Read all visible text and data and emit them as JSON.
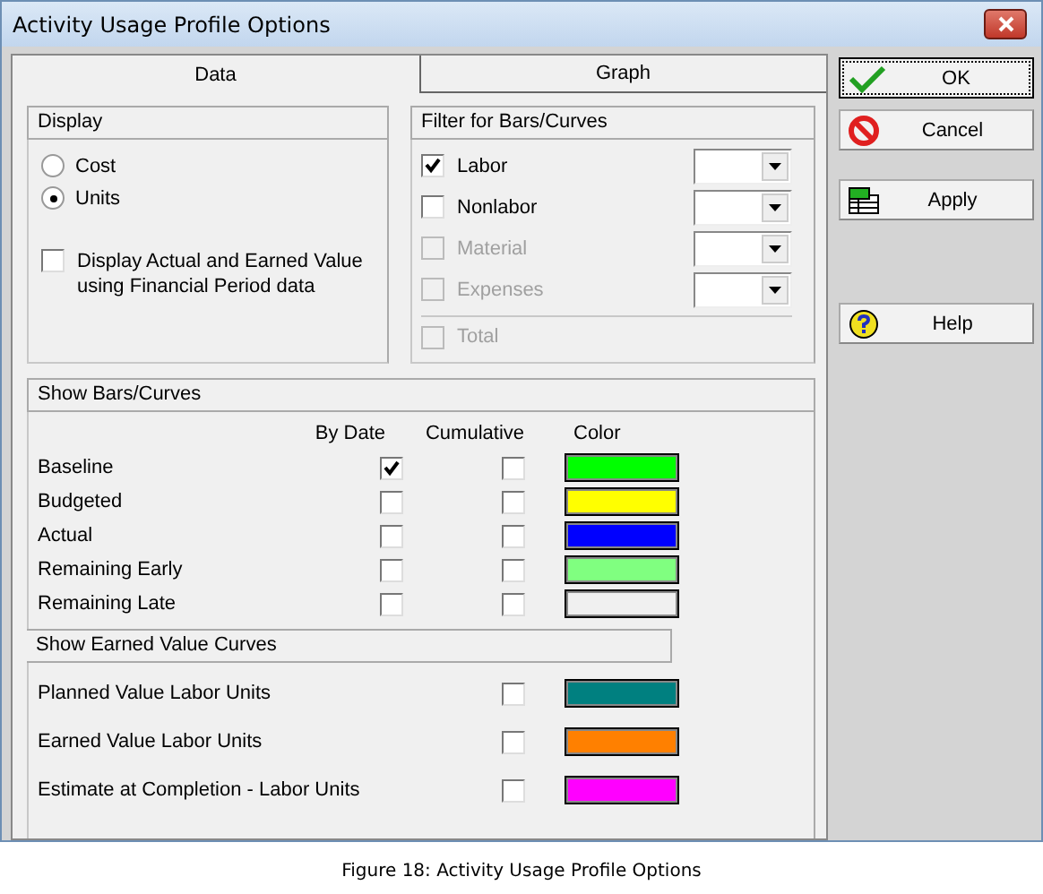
{
  "window": {
    "title": "Activity Usage Profile Options"
  },
  "tabs": [
    {
      "label": "Data",
      "selected": true
    },
    {
      "label": "Graph",
      "selected": false
    }
  ],
  "display": {
    "title": "Display",
    "options": [
      {
        "label": "Cost",
        "selected": false
      },
      {
        "label": "Units",
        "selected": true
      }
    ],
    "financial_period": {
      "label": "Display Actual and Earned Value using Financial Period data",
      "checked": false
    }
  },
  "filter": {
    "title": "Filter for Bars/Curves",
    "items": [
      {
        "label": "Labor",
        "checked": true,
        "disabled": false,
        "kind": "dropdown"
      },
      {
        "label": "Nonlabor",
        "checked": false,
        "disabled": false,
        "kind": "dropdown"
      },
      {
        "label": "Material",
        "checked": false,
        "disabled": true,
        "kind": "dropdown"
      },
      {
        "label": "Expenses",
        "checked": false,
        "disabled": true,
        "kind": "dropdown"
      },
      {
        "label": "Total",
        "checked": false,
        "disabled": true,
        "kind": "total"
      }
    ]
  },
  "bars": {
    "title": "Show Bars/Curves",
    "columns": [
      "By Date",
      "Cumulative",
      "Color"
    ],
    "rows": [
      {
        "label": "Baseline",
        "by_date": true,
        "cumulative": false,
        "color": "#00ff00"
      },
      {
        "label": "Budgeted",
        "by_date": false,
        "cumulative": false,
        "color": "#ffff00"
      },
      {
        "label": "Actual",
        "by_date": false,
        "cumulative": false,
        "color": "#0000ff"
      },
      {
        "label": "Remaining Early",
        "by_date": false,
        "cumulative": false,
        "color": "#80ff80"
      },
      {
        "label": "Remaining Late",
        "by_date": false,
        "cumulative": false,
        "color": "#f0f0f0"
      }
    ]
  },
  "earned_value": {
    "title": "Show Earned Value Curves",
    "rows": [
      {
        "label": "Planned Value Labor Units",
        "cumulative": false,
        "color": "#008080"
      },
      {
        "label": "Earned Value Labor Units",
        "cumulative": false,
        "color": "#ff8000"
      },
      {
        "label": "Estimate at Completion - Labor Units",
        "cumulative": false,
        "color": "#ff00ff"
      }
    ]
  },
  "buttons": [
    {
      "label": "OK",
      "kind": "ok",
      "default": true
    },
    {
      "label": "Cancel",
      "kind": "cancel",
      "default": false
    },
    {
      "label": "Apply",
      "kind": "apply",
      "default": false
    },
    {
      "label": "Help",
      "kind": "help",
      "default": false
    }
  ],
  "caption": "Figure 18: Activity Usage Profile Options"
}
